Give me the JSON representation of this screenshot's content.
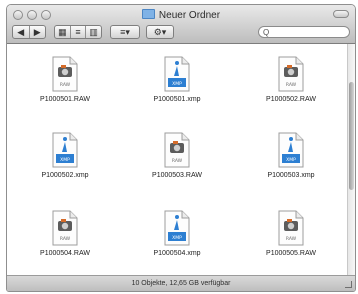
{
  "window": {
    "title": "Neuer Ordner"
  },
  "toolbar": {
    "back_forward": [
      "◀",
      "▶"
    ],
    "views": [
      "▦",
      "≡",
      "▥"
    ],
    "arrange_label": "≡▾",
    "action_label": "⚙▾",
    "search_placeholder": "Q"
  },
  "files": [
    {
      "name": "P1000501.RAW",
      "kind": "raw"
    },
    {
      "name": "P1000501.xmp",
      "kind": "xmp"
    },
    {
      "name": "P1000502.RAW",
      "kind": "raw"
    },
    {
      "name": "P1000502.xmp",
      "kind": "xmp"
    },
    {
      "name": "P1000503.RAW",
      "kind": "raw"
    },
    {
      "name": "P1000503.xmp",
      "kind": "xmp"
    },
    {
      "name": "P1000504.RAW",
      "kind": "raw"
    },
    {
      "name": "P1000504.xmp",
      "kind": "xmp"
    },
    {
      "name": "P1000505.RAW",
      "kind": "raw"
    }
  ],
  "file_icon_labels": {
    "raw": "RAW",
    "xmp": "XMP"
  },
  "status": {
    "text": "10 Objekte, 12,65 GB verfügbar"
  },
  "colors": {
    "xmp_blue": "#2d7fd2",
    "raw_orange": "#d56b29",
    "chrome_gray": "#c9c9c9"
  }
}
